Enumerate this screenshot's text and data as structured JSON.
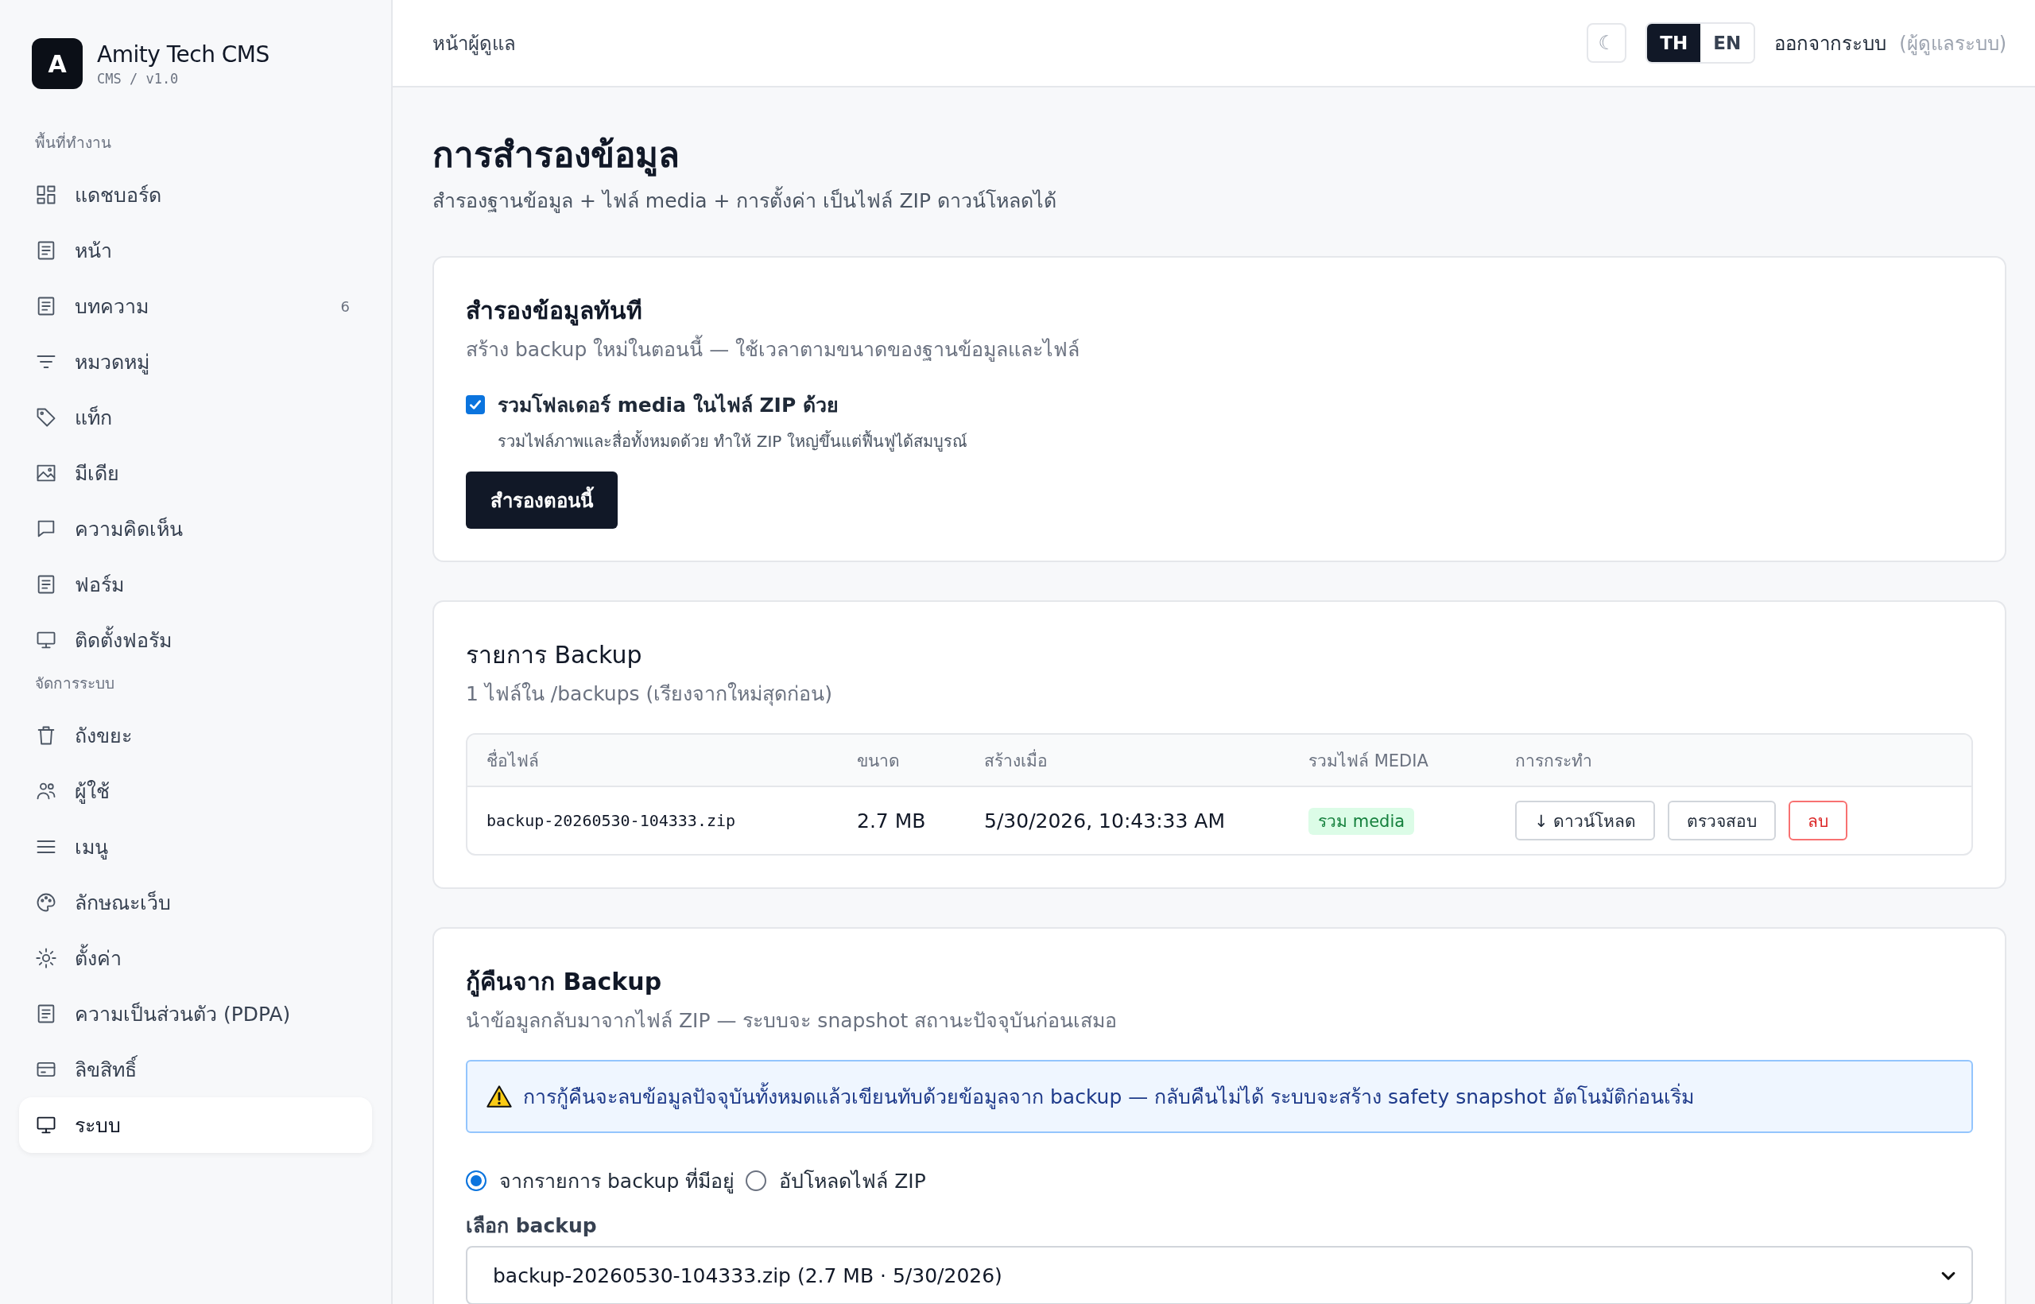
{
  "sidebar": {
    "brand": {
      "logo": "A",
      "title": "Amity Tech CMS",
      "subtitle": "CMS / v1.0"
    },
    "sections": [
      {
        "title": "พื้นที่ทำงาน",
        "items": [
          {
            "label": "แดชบอร์ด",
            "selected": false
          },
          {
            "label": "หน้า",
            "selected": false
          },
          {
            "label": "บทความ",
            "badge": "6",
            "selected": false
          },
          {
            "label": "หมวดหมู่",
            "selected": false
          },
          {
            "label": "แท็ก",
            "selected": false
          },
          {
            "label": "มีเดีย",
            "selected": false
          },
          {
            "label": "ความคิดเห็น",
            "selected": false
          },
          {
            "label": "ฟอร์ม",
            "selected": false
          },
          {
            "label": "ติดตั้งฟอรัม",
            "selected": false
          }
        ]
      },
      {
        "title": "จัดการระบบ",
        "items": [
          {
            "label": "ถังขยะ",
            "selected": false
          },
          {
            "label": "ผู้ใช้",
            "selected": false
          },
          {
            "label": "เมนู",
            "selected": false
          },
          {
            "label": "ลักษณะเว็บ",
            "selected": false
          },
          {
            "label": "ตั้งค่า",
            "selected": false
          },
          {
            "label": "ความเป็นส่วนตัว (PDPA)",
            "selected": false
          },
          {
            "label": "ลิขสิทธิ์",
            "selected": false
          },
          {
            "label": "ระบบ",
            "selected": true
          }
        ]
      }
    ]
  },
  "header": {
    "breadcrumb": "หน้าผู้ดูแล",
    "theme_toggle": "☾",
    "languages": [
      {
        "label": "TH",
        "selected": true
      },
      {
        "label": "EN",
        "selected": false
      }
    ],
    "logout": "ออกจากระบบ",
    "role": "(ผู้ดูแลระบบ)"
  },
  "page": {
    "title": "การสำรองข้อมูล",
    "subtitle": "สำรองฐานข้อมูล + ไฟล์ media + การตั้งค่า เป็นไฟล์ ZIP ดาวน์โหลดได้"
  },
  "backup_now": {
    "title": "สำรองข้อมูลทันที",
    "description": "สร้าง backup ใหม่ในตอนนี้ — ใช้เวลาตามขนาดของฐานข้อมูลและไฟล์",
    "include_media": {
      "label": "รวมโฟลเดอร์ media ในไฟล์ ZIP ด้วย",
      "hint": "รวมไฟล์ภาพและสื่อทั้งหมดด้วย ทำให้ ZIP ใหญ่ขึ้นแต่ฟื้นฟูได้สมบูรณ์",
      "checked": true
    },
    "button": "สำรองตอนนี้"
  },
  "backup_list": {
    "title": "รายการ Backup",
    "description": "1 ไฟล์ใน /backups (เรียงจากใหม่สุดก่อน)",
    "table": {
      "columns": [
        "ชื่อไฟล์",
        "ขนาด",
        "สร้างเมื่อ",
        "รวมไฟล์ MEDIA",
        "การกระทำ"
      ],
      "rows": [
        {
          "filename": "backup-20260530-104333.zip",
          "size": "2.7 MB",
          "created": "5/30/2026, 10:43:33 AM",
          "media": "รวม media",
          "actions": [
            {
              "label": "↓ ดาวน์โหลด",
              "kind": "default"
            },
            {
              "label": "ตรวจสอบ",
              "kind": "default"
            },
            {
              "label": "ลบ",
              "kind": "danger"
            }
          ]
        }
      ]
    }
  },
  "restore": {
    "title": "กู้คืนจาก Backup",
    "description": "นำข้อมูลกลับมาจากไฟล์ ZIP — ระบบจะ snapshot สถานะปัจจุบันก่อนเสมอ",
    "warning": "การกู้คืนจะลบข้อมูลปัจจุบันทั้งหมดแล้วเขียนทับด้วยข้อมูลจาก backup — กลับคืนไม่ได้ ระบบจะสร้าง safety snapshot อัตโนมัติก่อนเริ่ม",
    "sources": [
      {
        "label": "จากรายการ backup ที่มีอยู่",
        "selected": true
      },
      {
        "label": "อัปโหลดไฟล์ ZIP",
        "selected": false
      }
    ],
    "select_label": "เลือก backup",
    "select_value": "backup-20260530-104333.zip (2.7 MB · 5/30/2026)"
  }
}
